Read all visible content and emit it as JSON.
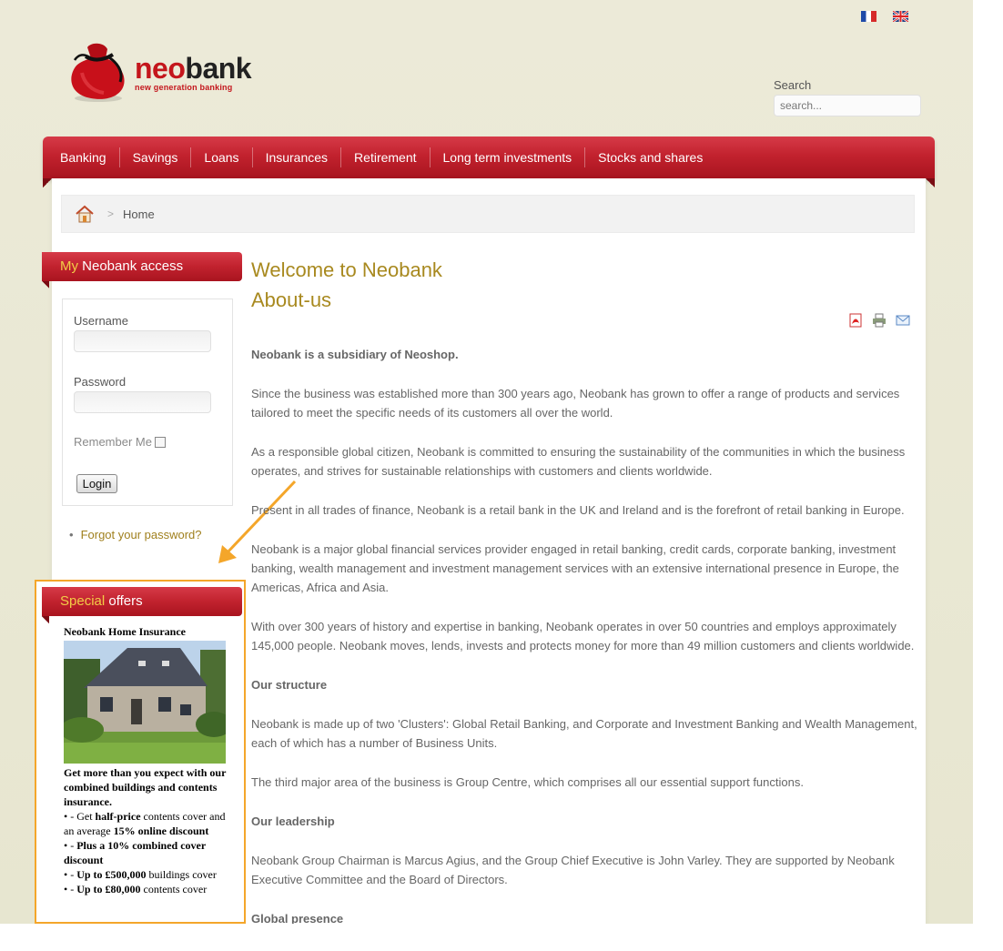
{
  "flags": {
    "fr": "French",
    "en": "English"
  },
  "logo": {
    "brand_neo": "neo",
    "brand_bank": "bank",
    "tagline": "new generation banking"
  },
  "search": {
    "label": "Search",
    "placeholder": "search..."
  },
  "nav": {
    "items": [
      "Banking",
      "Savings",
      "Loans",
      "Insurances",
      "Retirement",
      "Long term investments",
      "Stocks and shares"
    ]
  },
  "breadcrumb": {
    "current": "Home"
  },
  "login_module": {
    "title_highlight": "My",
    "title_rest": " Neobank access",
    "username_label": "Username",
    "password_label": "Password",
    "remember_label": "Remember Me",
    "login_button": "Login",
    "forgot_link": "Forgot your password?"
  },
  "offers_module": {
    "title_highlight": "Special",
    "title_rest": " offers",
    "offer_title": "Neobank Home Insurance",
    "intro": "Get more than you expect with our combined buildings and contents insurance.",
    "bullets": [
      {
        "pre": "•  - Get ",
        "bold": "half-price",
        "post": " contents cover and an average ",
        "bold2": "15% online discount",
        "post2": ""
      },
      {
        "pre": "•  - ",
        "bold": "Plus a 10% combined cover discount",
        "post": "",
        "bold2": "",
        "post2": ""
      },
      {
        "pre": "•  - ",
        "bold": "Up to £500,000",
        "post": " buildings cover",
        "bold2": "",
        "post2": ""
      },
      {
        "pre": "•  - ",
        "bold": "Up to £80,000",
        "post": " contents cover",
        "bold2": "",
        "post2": ""
      }
    ]
  },
  "article": {
    "title": "Welcome to Neobank",
    "subtitle": "About-us",
    "tools": [
      "pdf-icon",
      "print-icon",
      "email-icon"
    ],
    "intro": "Neobank is a subsidiary of Neoshop.",
    "p1": "Since the business was established more than 300 years ago, Neobank has grown to offer a range of products and services tailored to meet the specific needs of its customers all over the world.",
    "p2": "As a responsible global citizen, Neobank is committed to ensuring the sustainability of the communities in which the business operates, and strives for sustainable relationships with customers and clients worldwide.",
    "p3": "Present in all trades of finance, Neobank is a retail bank in the UK and Ireland and is the forefront of retail banking in Europe.",
    "p4": "Neobank is a major global financial services provider engaged in retail banking, credit cards, corporate banking, investment banking, wealth management and investment management services with an extensive international presence in Europe, the Americas, Africa and Asia.",
    "p5": "With over 300 years of history and expertise in banking, Neobank operates in over 50 countries and employs approximately 145,000 people. Neobank moves, lends, invests and protects money for more than 49 million customers and clients worldwide.",
    "h_structure": "Our structure",
    "p6": "Neobank is made up of two 'Clusters': Global Retail Banking, and Corporate and Investment Banking and Wealth Management, each of which has a number of Business Units.",
    "p7": "The third major area of the business is Group Centre, which comprises all our essential support functions.",
    "h_leadership": "Our leadership",
    "p8": "Neobank Group Chairman is Marcus Agius, and the Group Chief Executive is John Varley. They are supported by Neobank Executive Committee and the Board of Directors.",
    "h_global": "Global presence"
  },
  "colors": {
    "brand_red": "#c4161c",
    "gold": "#a8891f",
    "highlight_orange": "#f4a62a"
  }
}
